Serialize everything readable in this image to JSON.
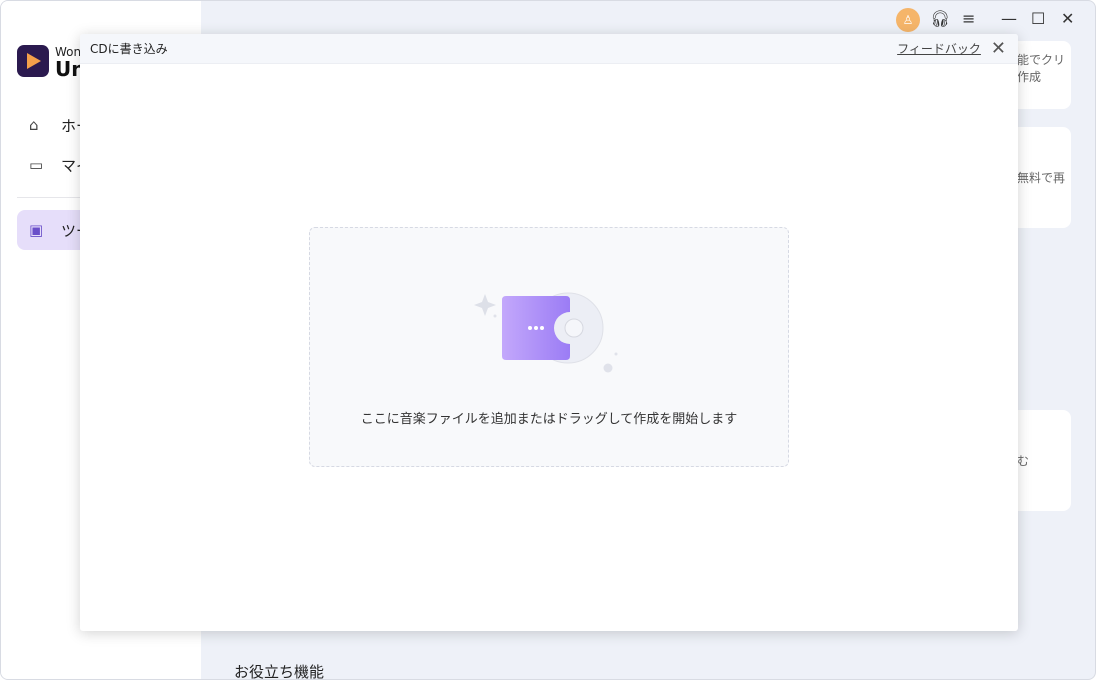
{
  "app": {
    "brand_line1": "Won",
    "brand_line2": "Un"
  },
  "sidebar": {
    "items": [
      {
        "label": "ホー",
        "icon": "home-icon"
      },
      {
        "label": "マイ",
        "icon": "folder-icon"
      },
      {
        "label": "ツー",
        "icon": "toolbox-icon",
        "active": true
      }
    ]
  },
  "titlebar": {
    "icons": [
      "user-avatar-icon",
      "headset-icon",
      "menu-icon",
      "minimize-icon",
      "maximize-icon",
      "close-icon"
    ]
  },
  "background_cards": [
    {
      "text": "能でクリ\n作成"
    },
    {
      "text": "無料で再"
    },
    {
      "text": "む"
    }
  ],
  "section_title": "お役立ち機能",
  "modal": {
    "title": "CDに書き込み",
    "feedback": "フィードバック",
    "drop_text": "ここに音楽ファイルを追加またはドラッグして作成を開始します"
  },
  "colors": {
    "accent": "#9b7cf5",
    "avatar": "#f5b56a",
    "active_nav": "#e6defa"
  }
}
